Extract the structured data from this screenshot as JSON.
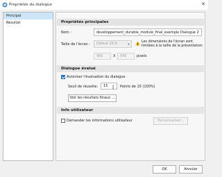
{
  "window": {
    "title": "Propriétés du dialogue",
    "close_glyph": "✕"
  },
  "sidebar": {
    "items": [
      {
        "label": "Principal",
        "selected": true
      },
      {
        "label": "Résultat",
        "selected": false
      }
    ]
  },
  "principal": {
    "header": "Propriétés principales",
    "name_label": "Nom :",
    "name_value": "developpement_durable_module_final_exemple Dialogue 2",
    "screen_size_label": "Taille de l'écran :",
    "screen_size_selected": "Défaut 16:9",
    "warning_text": "Les dimensions de l'écran sont limitées à la taille de la présentation",
    "width_value": "960",
    "x_sep": "X",
    "height_value": "540",
    "pixels_label": "pixels"
  },
  "evaluated": {
    "header": "Dialogue évalué",
    "allow_eval_label": "Autoriser l'évaluation du dialogue",
    "threshold_label": "Seuil de réussite:",
    "threshold_value": "15",
    "threshold_suffix": "Points de 15 (100%)",
    "results_button": "Voir les résultats finaux ..."
  },
  "user_info": {
    "header": "Info utilisateur",
    "ask_info_label": "Demander les informations utilisateur",
    "customize_button": "Personnaliser..."
  },
  "footer": {
    "ok": "OK",
    "cancel": "Annuler"
  },
  "colors": {
    "accent": "#1e73be",
    "selected_bg": "#cde6f7",
    "warning": "#f0b400"
  }
}
